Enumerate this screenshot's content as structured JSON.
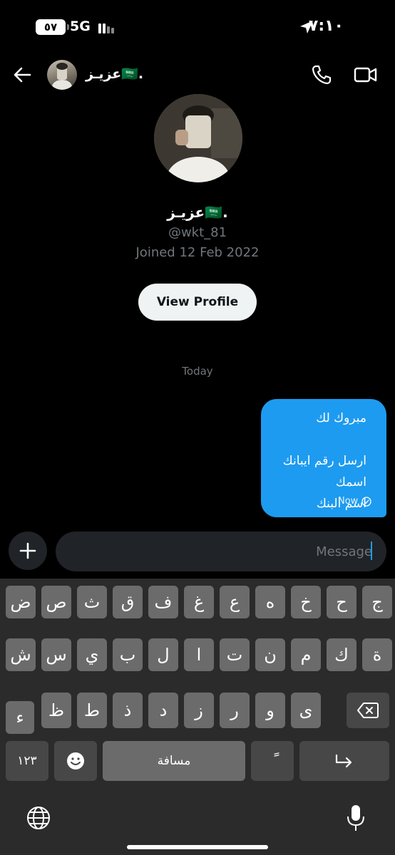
{
  "status_bar": {
    "battery": "٥٧",
    "network": "5G",
    "time": "٧:١٠"
  },
  "icons": {
    "back": "back-arrow-icon",
    "call": "phone-icon",
    "video": "video-camera-icon",
    "plus": "plus-icon",
    "read": "check-circle-icon",
    "globe": "globe-icon",
    "mic": "microphone-icon",
    "backspace": "backspace-icon",
    "emoji": "emoji-icon",
    "return": "return-icon",
    "location": "location-arrow-icon"
  },
  "colors": {
    "accent": "#1d9bf0",
    "background": "#000000",
    "muted": "#71767b"
  },
  "header": {
    "name": "عزيـز🇸🇦."
  },
  "profile": {
    "name": "عزيـز🇸🇦.",
    "handle": "@wkt_81",
    "joined": "Joined 12 Feb 2022",
    "view_profile_label": "View Profile"
  },
  "conversation": {
    "date_label": "Today",
    "message": {
      "text": "مبروك لك\n\nارسل رقم ايبانك\nاسمك\nاسم البنك",
      "time": "Now"
    }
  },
  "composer": {
    "placeholder": "Message"
  },
  "keyboard": {
    "row1": [
      "ض",
      "ص",
      "ث",
      "ق",
      "ف",
      "غ",
      "ع",
      "ه",
      "خ",
      "ح",
      "ج"
    ],
    "row2": [
      "ش",
      "س",
      "ي",
      "ب",
      "ل",
      "ا",
      "ت",
      "ن",
      "م",
      "ك",
      "ة"
    ],
    "row3": [
      "ء",
      "ظ",
      "ط",
      "ذ",
      "د",
      "ز",
      "ر",
      "و",
      "ى"
    ],
    "numbers_label": "١٢٣",
    "space_label": "مسافة",
    "diacritic_label": "ً"
  }
}
